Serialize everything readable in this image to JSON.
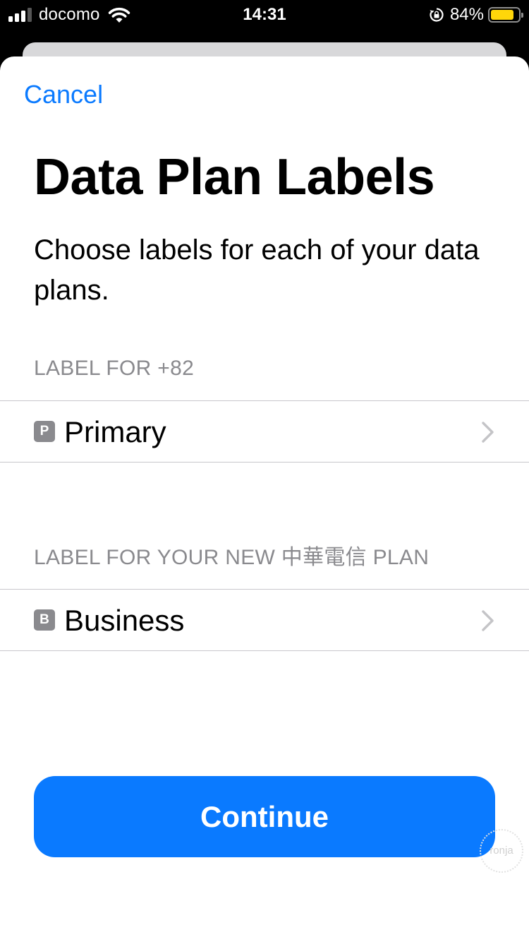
{
  "status_bar": {
    "carrier": "docomo",
    "time": "14:31",
    "battery_percent": "84%",
    "battery_level": 0.84,
    "signal_bars": 3,
    "battery_color": "#ffd60a"
  },
  "nav": {
    "cancel_label": "Cancel"
  },
  "header": {
    "title": "Data Plan Labels",
    "subtitle": "Choose labels for each of your data plans."
  },
  "sections": [
    {
      "header": "LABEL FOR +82",
      "item": {
        "badge": "P",
        "label": "Primary",
        "icon": "chevron-right-icon"
      }
    },
    {
      "header": "LABEL FOR YOUR NEW 中華電信 PLAN",
      "item": {
        "badge": "B",
        "label": "Business",
        "icon": "chevron-right-icon"
      }
    }
  ],
  "footer": {
    "continue_label": "Continue"
  },
  "watermark": "ronja",
  "colors": {
    "accent": "#0a7aff",
    "secondary_text": "#8a8a8e",
    "separator": "#c8c7cc"
  }
}
